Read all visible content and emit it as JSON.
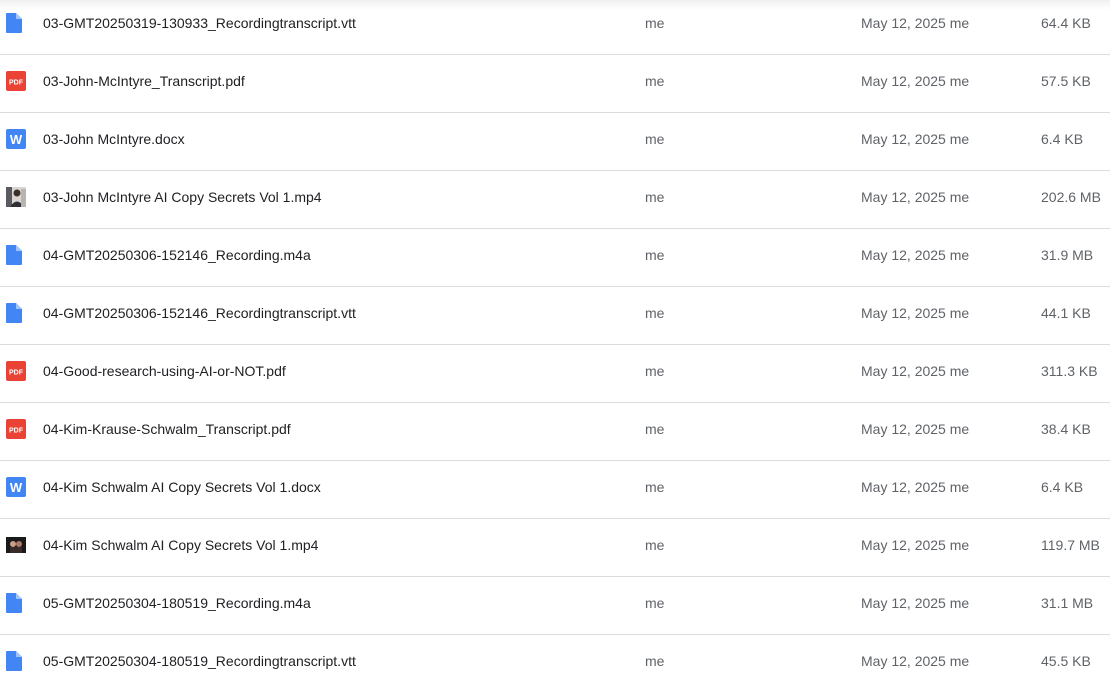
{
  "files": [
    {
      "name": "03-GMT20250319-130933_Recordingtranscript.vtt",
      "owner": "me",
      "modified": "May 12, 2025 me",
      "size": "64.4 KB",
      "icon": "generic-file-icon"
    },
    {
      "name": "03-John-McIntyre_Transcript.pdf",
      "owner": "me",
      "modified": "May 12, 2025 me",
      "size": "57.5 KB",
      "icon": "pdf-icon"
    },
    {
      "name": "03-John McIntyre.docx",
      "owner": "me",
      "modified": "May 12, 2025 me",
      "size": "6.4 KB",
      "icon": "word-icon"
    },
    {
      "name": "03-John McIntyre AI Copy Secrets Vol 1.mp4",
      "owner": "me",
      "modified": "May 12, 2025 me",
      "size": "202.6 MB",
      "icon": "video-thumbnail-icon"
    },
    {
      "name": "04-GMT20250306-152146_Recording.m4a",
      "owner": "me",
      "modified": "May 12, 2025 me",
      "size": "31.9 MB",
      "icon": "generic-file-icon"
    },
    {
      "name": "04-GMT20250306-152146_Recordingtranscript.vtt",
      "owner": "me",
      "modified": "May 12, 2025 me",
      "size": "44.1 KB",
      "icon": "generic-file-icon"
    },
    {
      "name": "04-Good-research-using-AI-or-NOT.pdf",
      "owner": "me",
      "modified": "May 12, 2025 me",
      "size": "311.3 KB",
      "icon": "pdf-icon"
    },
    {
      "name": "04-Kim-Krause-Schwalm_Transcript.pdf",
      "owner": "me",
      "modified": "May 12, 2025 me",
      "size": "38.4 KB",
      "icon": "pdf-icon"
    },
    {
      "name": "04-Kim Schwalm AI Copy Secrets Vol 1.docx",
      "owner": "me",
      "modified": "May 12, 2025 me",
      "size": "6.4 KB",
      "icon": "word-icon"
    },
    {
      "name": "04-Kim Schwalm AI Copy Secrets Vol 1.mp4",
      "owner": "me",
      "modified": "May 12, 2025 me",
      "size": "119.7 MB",
      "icon": "video-thumbnail-icon"
    },
    {
      "name": "05-GMT20250304-180519_Recording.m4a",
      "owner": "me",
      "modified": "May 12, 2025 me",
      "size": "31.1 MB",
      "icon": "generic-file-icon"
    },
    {
      "name": "05-GMT20250304-180519_Recordingtranscript.vtt",
      "owner": "me",
      "modified": "May 12, 2025 me",
      "size": "45.5 KB",
      "icon": "generic-file-icon"
    }
  ],
  "colors": {
    "generic": "#4285f4",
    "pdf": "#ea4335",
    "word": "#4285f4",
    "divider": "#dadce0"
  }
}
